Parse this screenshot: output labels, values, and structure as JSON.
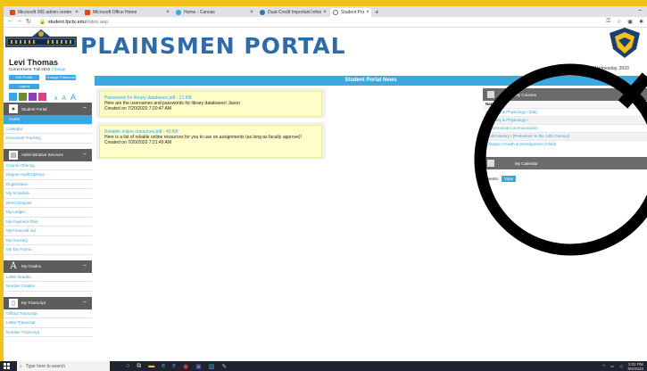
{
  "browser": {
    "tabs": [
      {
        "label": "Microsoft 365 admin center - Ho",
        "icon": "office-icon"
      },
      {
        "label": "Microsoft Office Home",
        "icon": "office-icon"
      },
      {
        "label": "Home - Canvas",
        "icon": "canvas-icon"
      },
      {
        "label": "Dual-Credit Important Informati",
        "icon": "globe-icon"
      },
      {
        "label": "Student Portal News",
        "icon": "globe-icon"
      }
    ],
    "url_host": "student.fpctx.edu",
    "url_path": "/index.asp"
  },
  "header": {
    "portal_title": "PLAINSMEN PORTAL",
    "user_name": "Levi Thomas",
    "term_label": "Current term: Fall 2020",
    "change_link": "Change",
    "date_text": "Wednesday, 2020",
    "buttons": [
      "Edit Profile",
      "Change Password"
    ],
    "logout": "Logout",
    "swatch_colors": [
      "#3aa8df",
      "#6a8f2a",
      "#8a3fb8",
      "#e23d8d"
    ],
    "font_sizes": [
      "A",
      "A",
      "A"
    ]
  },
  "sidebar": {
    "sections": [
      {
        "title": "Student Portal",
        "icon": "person-icon",
        "items": [
          "Home",
          "Calendar",
          "Document Tracking"
        ]
      },
      {
        "title": "Administrative Services",
        "icon": "id-card-icon",
        "items": [
          "Course Offering",
          "Degree Audit Options",
          "Registration",
          "My Schedule",
          "Direct Deposit",
          "My Ledger",
          "My Payment Plan",
          "My Financial Aid",
          "My Housing",
          "My Tax Forms"
        ]
      },
      {
        "title": "My Grades",
        "icon": "grade-a-icon",
        "items": [
          "Letter Grades",
          "Number Grades"
        ]
      },
      {
        "title": "My Transcript",
        "icon": "document-icon",
        "items": [
          "Official Transcript",
          "Letter Transcript",
          "Number Transcript"
        ]
      }
    ]
  },
  "main": {
    "heading": "Student Portal News",
    "news": [
      {
        "link": "Passwords for library databases.pdf - 21 KB",
        "body": "Here are the usernames and passwords for library databases! Jason",
        "created": "Created on 7/20/2020 7:20:47 AM"
      },
      {
        "link": "Reliable online resources.pdf - 45 KB",
        "body": "Here is a list of reliable online resources for you to use on assignments (as long as faculty approve)!",
        "created": "Created on 7/20/2020 7:21:49 AM"
      }
    ]
  },
  "right_panel": {
    "courses_title": "My Courses",
    "courses_header": "Name",
    "courses": [
      "Anatomy & Physiology I (lab)",
      "Anatomy & Physiology I",
      "Interpersonal Communication",
      "World History I (Prehistoric to the 14th Century)",
      "Lifespan Growth & Development (Child)"
    ],
    "calendar_title": "My Calendar",
    "events_label": "Events:",
    "view_button": "View"
  },
  "taskbar": {
    "search_placeholder": "Type here to search",
    "time": "3:02 PM",
    "date": "8/5/2020"
  }
}
